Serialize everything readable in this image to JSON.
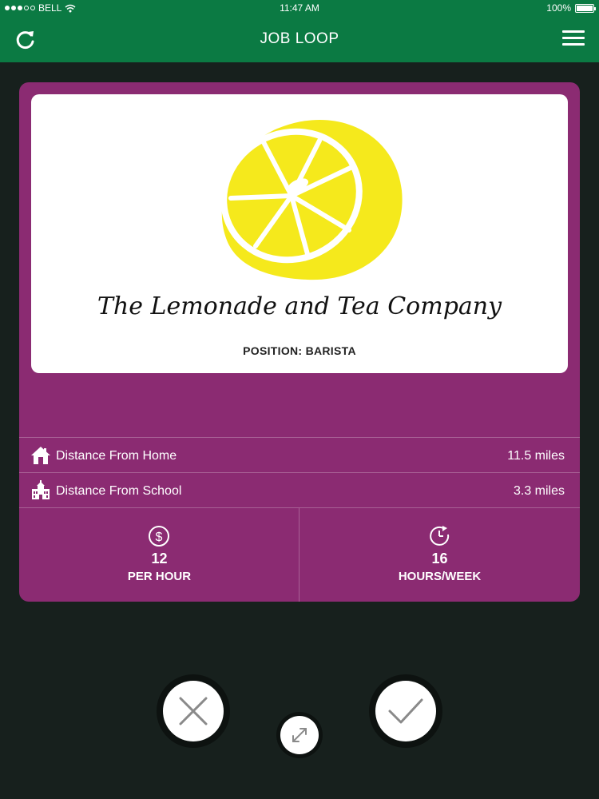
{
  "status_bar": {
    "carrier": "BELL",
    "time": "11:47 AM",
    "battery": "100%"
  },
  "header": {
    "title": "JOB LOOP",
    "left_icon": "refresh-icon",
    "right_icon": "hamburger-menu-icon"
  },
  "job_card": {
    "company_name": "The Lemonade and Tea Company",
    "position": "POSITION: BARISTA",
    "distance_home_label": "Distance From Home",
    "distance_home_value": "11.5 miles",
    "distance_school_label": "Distance From School",
    "distance_school_value": "3.3 miles",
    "pay_value": "12",
    "pay_unit": "PER HOUR",
    "hours_value": "16",
    "hours_unit": "HOURS/WEEK"
  },
  "actions": {
    "reject_icon": "x-icon",
    "accept_icon": "checkmark-icon",
    "expand_icon": "expand-icon"
  },
  "colors": {
    "header": "#0b7a43",
    "card": "#8b2b72",
    "background": "#17201d",
    "lemon": "#f5e91c"
  }
}
